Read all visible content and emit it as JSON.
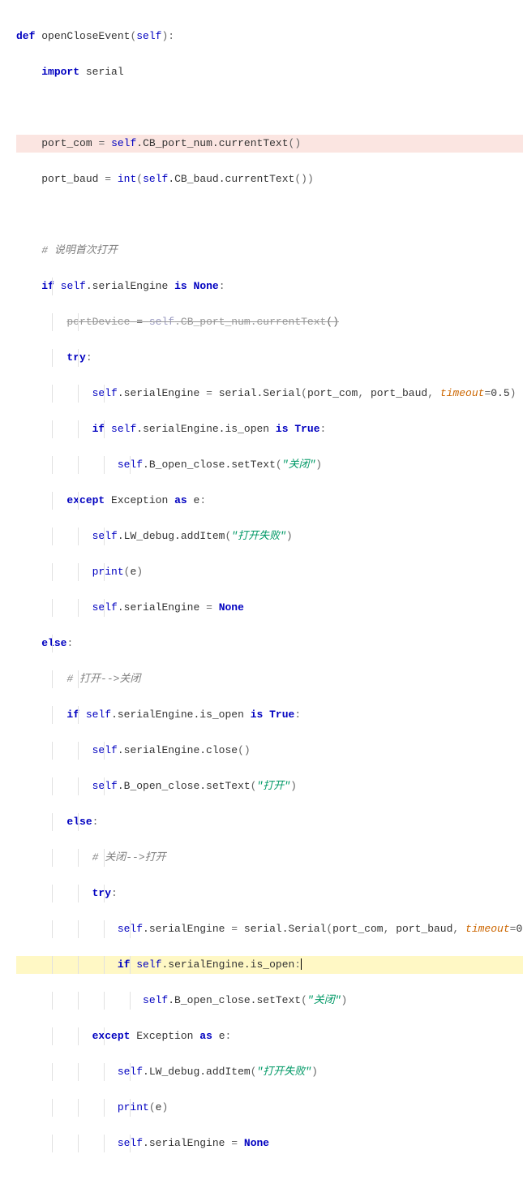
{
  "code": {
    "l1_def": "def",
    "l1_name": "openCloseEvent",
    "l1_self": "self",
    "l2_import": "import",
    "l2_serial": "serial",
    "l4_var": "port_com",
    "l4_eq": "=",
    "l4_self": "self",
    "l4_attr": ".CB_port_num.currentText",
    "l5_var": "port_baud",
    "l5_eq": "=",
    "l5_int": "int",
    "l5_self": "self",
    "l5_attr": ".CB_baud.currentText",
    "l7_cmt": "# 说明首次打开",
    "l8_if": "if",
    "l8_self": "self",
    "l8_attr": ".serialEngine",
    "l8_is": "is",
    "l8_none": "None",
    "l9_var": "portDevice",
    "l9_eq": "=",
    "l9_self": "self",
    "l9_attr": ".CB_port_num.currentText",
    "l10_try": "try",
    "l11_self": "self",
    "l11_attr": ".serialEngine",
    "l11_eq": "=",
    "l11_serial": "serial.Serial",
    "l11_p1": "port_com",
    "l11_p2": "port_baud",
    "l11_p3k": "timeout",
    "l11_p3v": "0.5",
    "l12_if": "if",
    "l12_self": "self",
    "l12_attr": ".serialEngine.is_open",
    "l12_is": "is",
    "l12_true": "True",
    "l13_self": "self",
    "l13_attr": ".B_open_close.setText",
    "l13_str": "\"关闭\"",
    "l14_except": "except",
    "l14_exc": "Exception",
    "l14_as": "as",
    "l14_e": "e",
    "l15_self": "self",
    "l15_attr": ".LW_debug.addItem",
    "l15_str": "\"打开失败\"",
    "l16_print": "print",
    "l16_e": "e",
    "l17_self": "self",
    "l17_attr": ".serialEngine",
    "l17_eq": "=",
    "l17_none": "None",
    "l18_else": "else",
    "l19_cmt": "# 打开-->关闭",
    "l20_if": "if",
    "l20_self": "self",
    "l20_attr": ".serialEngine.is_open",
    "l20_is": "is",
    "l20_true": "True",
    "l21_self": "self",
    "l21_attr": ".serialEngine.close",
    "l22_self": "self",
    "l22_attr": ".B_open_close.setText",
    "l22_str": "\"打开\"",
    "l23_else": "else",
    "l24_cmt": "# 关闭-->打开",
    "l25_try": "try",
    "l26_self": "self",
    "l26_attr": ".serialEngine",
    "l26_eq": "=",
    "l26_serial": "serial.Serial",
    "l26_p1": "port_com",
    "l26_p2": "port_baud",
    "l26_p3k": "timeout",
    "l26_p3v": "0",
    "l27_if": "if",
    "l27_self": "self",
    "l27_attr": ".serialEngine.is_open",
    "l28_self": "self",
    "l28_attr": ".B_open_close.setText",
    "l28_str": "\"关闭\"",
    "l29_except": "except",
    "l29_exc": "Exception",
    "l29_as": "as",
    "l29_e": "e",
    "l30_self": "self",
    "l30_attr": ".LW_debug.addItem",
    "l30_str": "\"打开失败\"",
    "l31_print": "print",
    "l31_e": "e",
    "l32_self": "self",
    "l32_attr": ".serialEngine",
    "l32_eq": "=",
    "l32_none": "None"
  }
}
